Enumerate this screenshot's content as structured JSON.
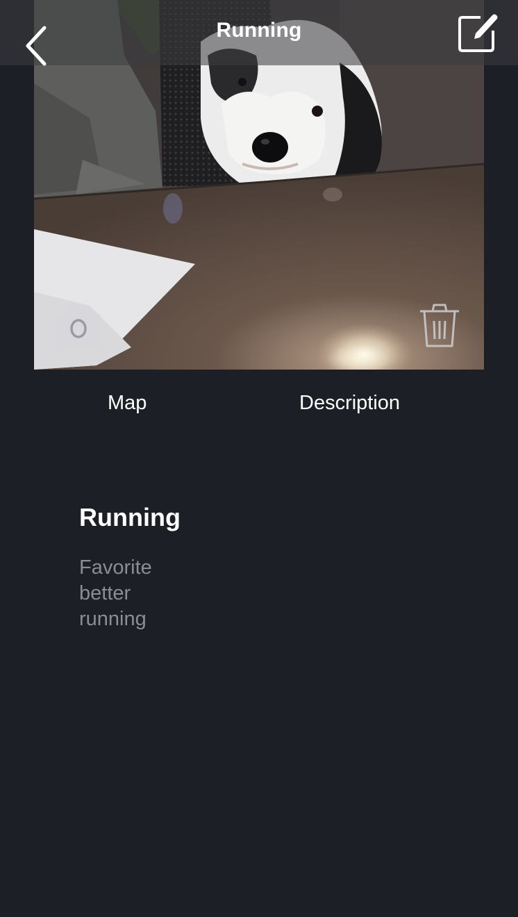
{
  "nav": {
    "title": "Running",
    "back_icon": "chevron-left-icon",
    "edit_icon": "compose-icon"
  },
  "photo": {
    "subject": "dog photo",
    "camera_icon": "camera-icon",
    "trash_icon": "trash-icon"
  },
  "tabs": [
    {
      "label": "Map"
    },
    {
      "label": "Description"
    }
  ],
  "entry": {
    "title": "Running",
    "lines": [
      "Favorite",
      "better",
      "running"
    ]
  },
  "colors": {
    "background": "#1d1f27",
    "text_primary": "#ffffff",
    "text_secondary": "#8b8d93"
  }
}
